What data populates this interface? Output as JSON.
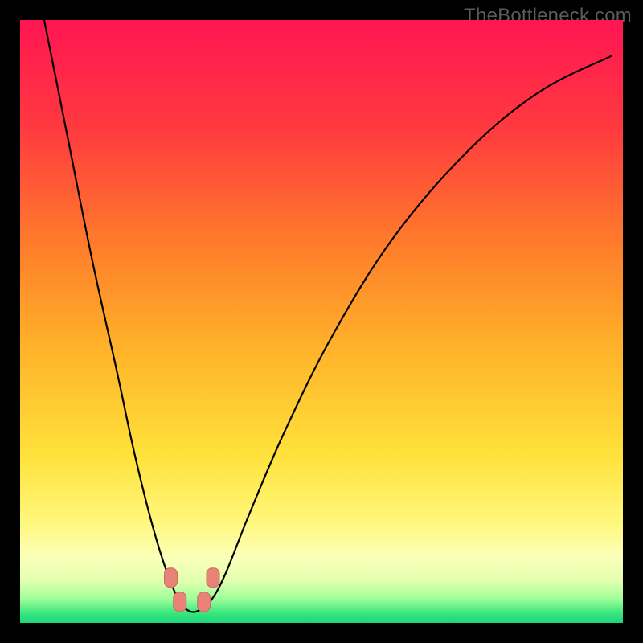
{
  "watermark": "TheBottleneck.com",
  "colors": {
    "frame": "#000000",
    "curve": "#000000",
    "marker_fill": "#e98277",
    "marker_stroke": "#c96a60",
    "gradient_stops": [
      {
        "offset": 0.0,
        "color": "#ff1552"
      },
      {
        "offset": 0.18,
        "color": "#ff3a3f"
      },
      {
        "offset": 0.38,
        "color": "#ff7f2a"
      },
      {
        "offset": 0.55,
        "color": "#ffb42a"
      },
      {
        "offset": 0.72,
        "color": "#ffe13a"
      },
      {
        "offset": 0.83,
        "color": "#fff77a"
      },
      {
        "offset": 0.89,
        "color": "#fcffb8"
      },
      {
        "offset": 0.93,
        "color": "#e2ffb0"
      },
      {
        "offset": 0.96,
        "color": "#9fff9a"
      },
      {
        "offset": 0.985,
        "color": "#35e57e"
      },
      {
        "offset": 1.0,
        "color": "#1dd67a"
      }
    ]
  },
  "chart_data": {
    "type": "line",
    "title": "",
    "xlabel": "",
    "ylabel": "",
    "xlim": [
      0,
      100
    ],
    "ylim": [
      0,
      100
    ],
    "grid": false,
    "legend": false,
    "series": [
      {
        "name": "bottleneck-curve",
        "x": [
          4,
          8,
          12,
          16,
          19,
          22,
          24.5,
          26.5,
          28,
          29.5,
          31.5,
          34,
          38,
          44,
          52,
          62,
          74,
          86,
          98
        ],
        "y": [
          100,
          80,
          60,
          42,
          28,
          16,
          8,
          3.5,
          2,
          2,
          3.5,
          8,
          18,
          32,
          48,
          64,
          78,
          88,
          94
        ]
      }
    ],
    "markers": [
      {
        "x": 25.0,
        "y": 7.5
      },
      {
        "x": 26.5,
        "y": 3.5
      },
      {
        "x": 30.5,
        "y": 3.5
      },
      {
        "x": 32.0,
        "y": 7.5
      }
    ],
    "annotations": []
  }
}
